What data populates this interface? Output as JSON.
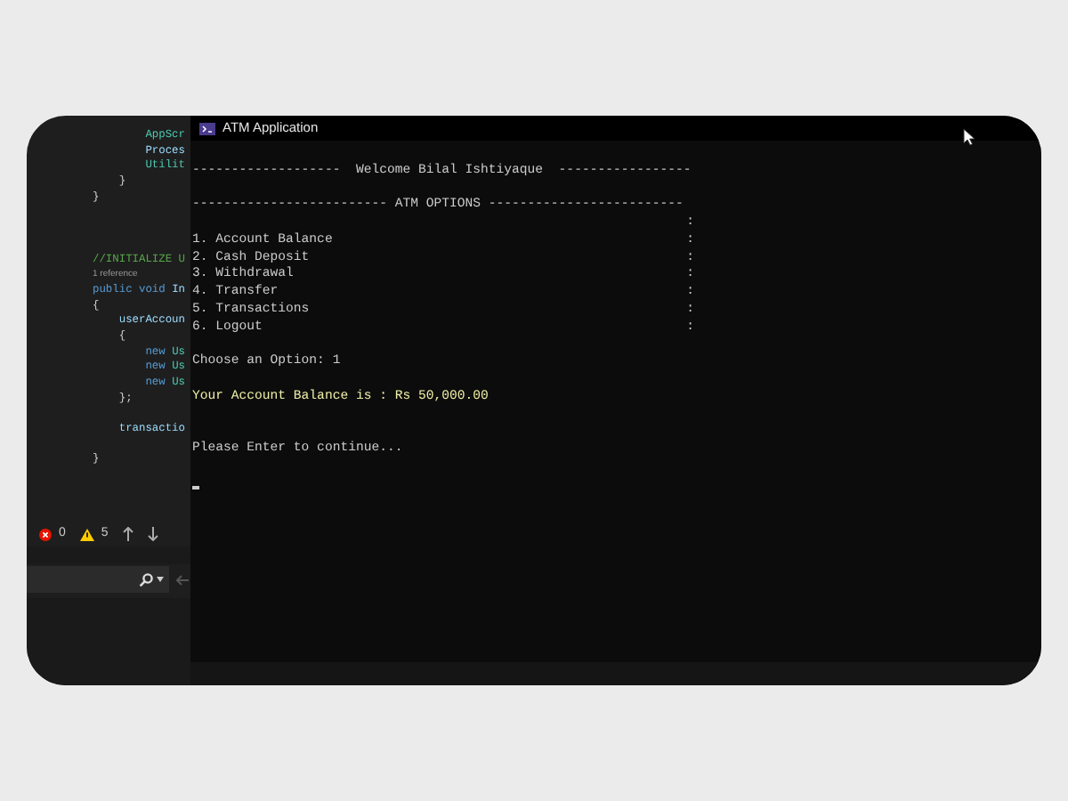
{
  "editor": {
    "lines": [
      {
        "kind": "code",
        "segments": [
          {
            "text": "        AppScr",
            "kind": "type"
          }
        ]
      },
      {
        "kind": "code",
        "segments": [
          {
            "text": "        Proces",
            "kind": "ident"
          }
        ]
      },
      {
        "kind": "code",
        "segments": [
          {
            "text": "        Utilit",
            "kind": "type"
          }
        ]
      },
      {
        "kind": "code",
        "segments": [
          {
            "text": "    }",
            "kind": "plain"
          }
        ]
      },
      {
        "kind": "code",
        "segments": [
          {
            "text": "}",
            "kind": "plain"
          }
        ]
      },
      {
        "kind": "blank"
      },
      {
        "kind": "blank"
      },
      {
        "kind": "blank"
      },
      {
        "kind": "code",
        "segments": [
          {
            "text": "//INITIALIZE U",
            "kind": "comment"
          }
        ]
      },
      {
        "kind": "code",
        "segments": [
          {
            "text": "1 reference",
            "kind": "meta"
          }
        ]
      },
      {
        "kind": "code",
        "segments": [
          {
            "text": "public void ",
            "kind": "keyword"
          },
          {
            "text": "In",
            "kind": "ident"
          }
        ]
      },
      {
        "kind": "code",
        "segments": [
          {
            "text": "{",
            "kind": "plain"
          }
        ]
      },
      {
        "kind": "code",
        "segments": [
          {
            "text": "    userAccoun",
            "kind": "ident"
          }
        ]
      },
      {
        "kind": "code",
        "segments": [
          {
            "text": "    {",
            "kind": "plain"
          }
        ]
      },
      {
        "kind": "code",
        "segments": [
          {
            "text": "        new ",
            "kind": "keyword"
          },
          {
            "text": "Us",
            "kind": "type"
          }
        ]
      },
      {
        "kind": "code",
        "segments": [
          {
            "text": "        new ",
            "kind": "keyword"
          },
          {
            "text": "Us",
            "kind": "type"
          }
        ]
      },
      {
        "kind": "code",
        "segments": [
          {
            "text": "        new ",
            "kind": "keyword"
          },
          {
            "text": "Us",
            "kind": "type"
          }
        ]
      },
      {
        "kind": "code",
        "segments": [
          {
            "text": "    };",
            "kind": "plain"
          }
        ]
      },
      {
        "kind": "blank"
      },
      {
        "kind": "code",
        "segments": [
          {
            "text": "    transactio",
            "kind": "ident"
          }
        ]
      },
      {
        "kind": "blank"
      },
      {
        "kind": "code",
        "segments": [
          {
            "text": "}",
            "kind": "plain"
          }
        ]
      }
    ],
    "status": {
      "errors": "0",
      "warnings": "5"
    }
  },
  "console": {
    "title": "ATM Application",
    "lines": [
      {
        "kind": "blank"
      },
      {
        "kind": "text",
        "text": "-------------------  Welcome Bilal Ishtiyaque  -----------------"
      },
      {
        "kind": "blank"
      },
      {
        "kind": "text",
        "text": "------------------------- ATM OPTIONS -------------------------"
      },
      {
        "kind": "colon_only",
        "suffix": ":"
      },
      {
        "kind": "option",
        "text": "1. Account Balance",
        "suffix": ":"
      },
      {
        "kind": "option",
        "text": "2. Cash Deposit",
        "suffix": ":"
      },
      {
        "kind": "option",
        "text": "3. Withdrawal",
        "suffix": ":"
      },
      {
        "kind": "option",
        "text": "4. Transfer",
        "suffix": ":"
      },
      {
        "kind": "option",
        "text": "5. Transactions",
        "suffix": ":"
      },
      {
        "kind": "option",
        "text": "6. Logout",
        "suffix": ":"
      },
      {
        "kind": "blank"
      },
      {
        "kind": "text",
        "text": "Choose an Option: 1"
      },
      {
        "kind": "blank"
      },
      {
        "kind": "highlight",
        "text": "Your Account Balance is : Rs 50,000.00"
      },
      {
        "kind": "blank"
      },
      {
        "kind": "blank"
      },
      {
        "kind": "text",
        "text": "Please Enter to continue..."
      },
      {
        "kind": "blank"
      },
      {
        "kind": "cursor"
      }
    ]
  }
}
